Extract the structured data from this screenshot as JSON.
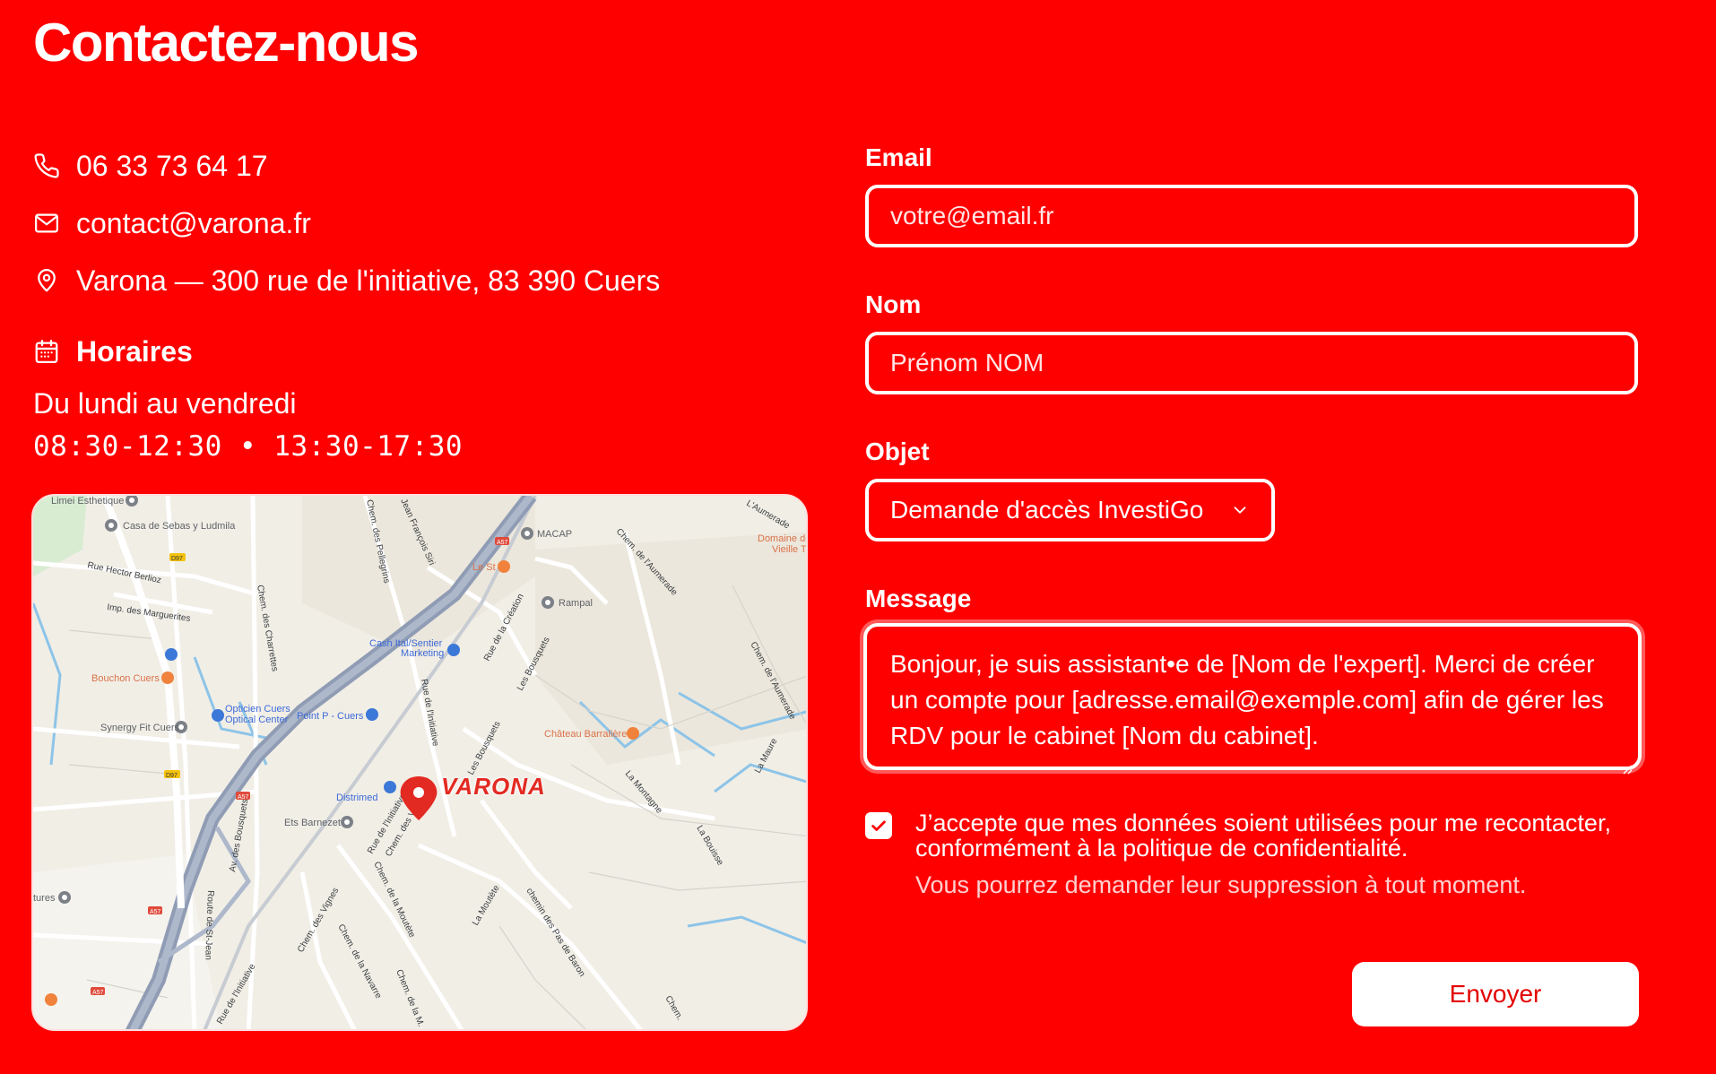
{
  "page": {
    "title": "Contactez-nous"
  },
  "contact": {
    "phone": "06 33 73 64 17",
    "email": "contact@varona.fr",
    "address": "Varona — 300 rue de l'initiative, 83 390 Cuers"
  },
  "hours": {
    "heading": "Horaires",
    "days": "Du lundi au vendredi",
    "times": "08:30-12:30 • 13:30-17:30"
  },
  "map": {
    "marker_label": "VARONA",
    "places": [
      "Limei Esthetique",
      "Casa de Sebas y Ludmila",
      "MACAP",
      "Le St",
      "Rampal",
      "Cash Ital/Sentier Marketing",
      "Bouchon Cuers",
      "Opticien Cuers Optical Center",
      "Point P - Cuers",
      "Synergy Fit Cuers",
      "Château Barralière",
      "Distrimed",
      "Ets Barnezet",
      "Domaine de Vieille Tour",
      "tures"
    ],
    "roads": [
      "Rue Hector Berlioz",
      "Imp. des Marguerites",
      "Chem. des Charrettes",
      "Chem. des Pellegrins",
      "Chem. de l'Aumerade",
      "L'Aumerade",
      "Rue de la Création",
      "Les Bousquets",
      "Rue de l'Initiative",
      "Chem. des Vignes",
      "Av. des Bousquets",
      "Route de St-Jean",
      "Chem. de la Navarre",
      "Chem. de la Moutète",
      "La Moutète",
      "chemin des Pas de Baron",
      "La Montagne",
      "La Bouisse",
      "La Maure",
      "Jean François Siri",
      "A57",
      "D97"
    ]
  },
  "form": {
    "email_label": "Email",
    "email_placeholder": "votre@email.fr",
    "name_label": "Nom",
    "name_placeholder": "Prénom NOM",
    "subject_label": "Objet",
    "subject_selected": "Demande d'accès InvestiGo",
    "message_label": "Message",
    "message_value": "Bonjour, je suis assistant•e de [Nom de l'expert]. Merci de créer un compte pour [adresse.email@exemple.com] afin de gérer les RDV pour le cabinet [Nom du cabinet].",
    "consent_text": "J’accepte que mes données soient utilisées pour me recontacter, conformément à la politique de confidentialité.",
    "consent_note": "Vous pourrez demander leur suppression à tout moment.",
    "consent_checked": true,
    "submit_label": "Envoyer"
  },
  "colors": {
    "background": "#ff0000",
    "foreground": "#ffffff",
    "button_text": "#e30000"
  }
}
